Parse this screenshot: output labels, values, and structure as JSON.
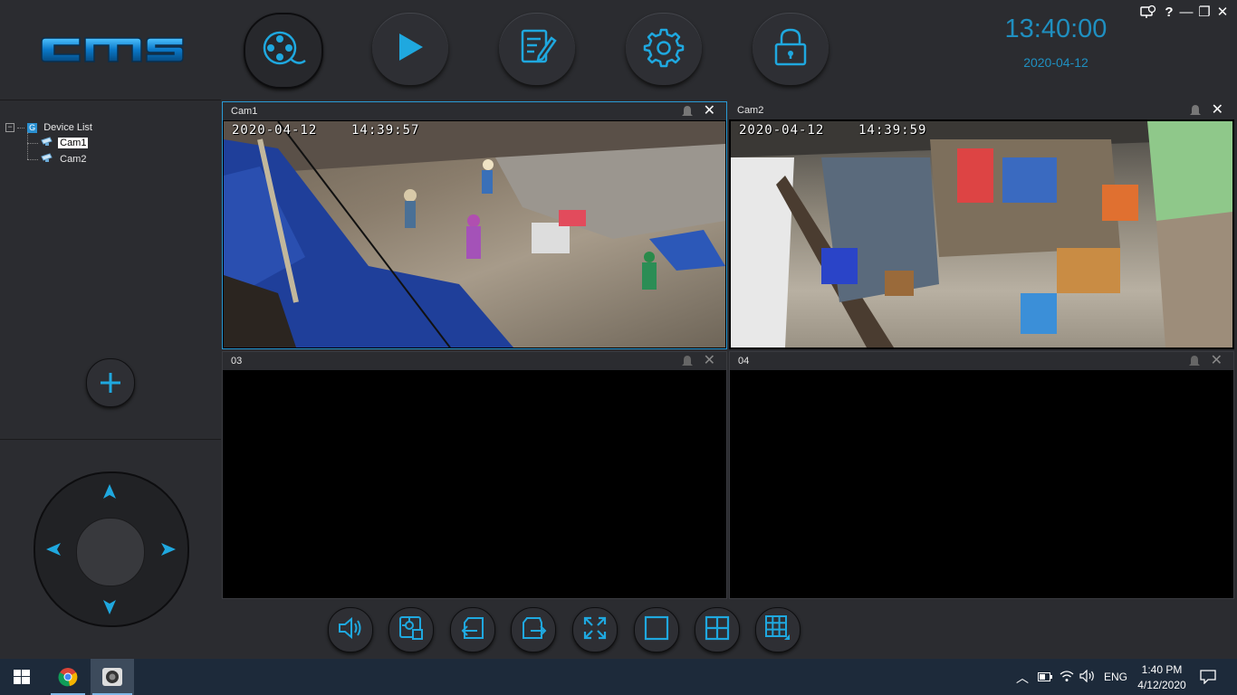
{
  "app": {
    "logo_text": "CMS",
    "accent_color": "#1f8fc0",
    "clock_time": "13:40:00",
    "clock_date": "2020-04-12"
  },
  "nav": [
    {
      "name": "live-view",
      "icon": "film-reel-icon",
      "active": true
    },
    {
      "name": "playback",
      "icon": "play-icon",
      "active": false
    },
    {
      "name": "log",
      "icon": "edit-document-icon",
      "active": false
    },
    {
      "name": "settings",
      "icon": "gear-icon",
      "active": false
    },
    {
      "name": "lock",
      "icon": "lock-icon",
      "active": false
    }
  ],
  "window_controls": {
    "network_icon": "network-icon",
    "help": "?",
    "minimize": "—",
    "restore": "❐",
    "close": "✕"
  },
  "device_tree": {
    "root_label": "Device List",
    "root_badge": "G",
    "devices": [
      {
        "label": "Cam1",
        "selected": true
      },
      {
        "label": "Cam2",
        "selected": false
      }
    ]
  },
  "tiles": [
    {
      "title": "Cam1",
      "osd": "2020-04-12    14:39:57",
      "has_video": true,
      "active": true
    },
    {
      "title": "Cam2",
      "osd": "2020-04-12    14:39:59",
      "has_video": true,
      "active": false
    },
    {
      "title": "03",
      "osd": "",
      "has_video": false,
      "active": false
    },
    {
      "title": "04",
      "osd": "",
      "has_video": false,
      "active": false
    }
  ],
  "toolbar": [
    {
      "name": "audio",
      "icon": "speaker-icon"
    },
    {
      "name": "snapshot",
      "icon": "capture-icon"
    },
    {
      "name": "previous-page",
      "icon": "page-prev-icon"
    },
    {
      "name": "next-page",
      "icon": "page-next-icon"
    },
    {
      "name": "fullscreen",
      "icon": "fullscreen-icon"
    },
    {
      "name": "single-view",
      "icon": "layout-1-icon"
    },
    {
      "name": "quad-view",
      "icon": "layout-4-icon"
    },
    {
      "name": "multi-view",
      "icon": "layout-9-icon"
    }
  ],
  "taskbar": {
    "language": "ENG",
    "time": "1:40 PM",
    "date": "4/12/2020"
  }
}
